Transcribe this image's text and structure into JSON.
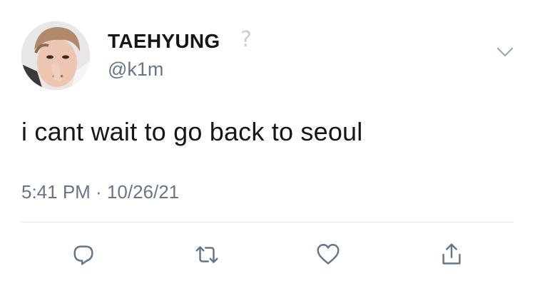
{
  "tweet": {
    "display_name": "TAEHYUNG",
    "verified_icon": "question-mark",
    "handle": "@k1m",
    "text": "i cant wait to go back to seoul",
    "timestamp": "5:41 PM · 10/26/21"
  },
  "actions": [
    {
      "name": "reply",
      "icon": "reply-icon"
    },
    {
      "name": "retweet",
      "icon": "retweet-icon"
    },
    {
      "name": "like",
      "icon": "heart-icon"
    },
    {
      "name": "share",
      "icon": "share-icon"
    }
  ],
  "colors": {
    "text": "#14171a",
    "secondary": "#657786",
    "icon": "#657786",
    "divider": "#e1e8ed"
  }
}
